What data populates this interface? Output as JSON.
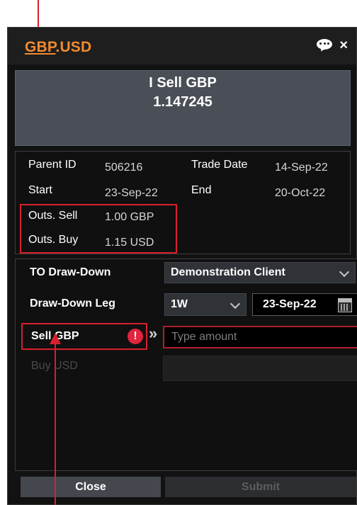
{
  "window": {
    "title_base": "GBP",
    "title_rest": ".USD",
    "icons": [
      "chat-icon",
      "close-icon"
    ],
    "close_glyph": "×"
  },
  "rate": {
    "direction": "I Sell GBP",
    "value": "1.147245"
  },
  "info": {
    "parent_id_label": "Parent ID",
    "parent_id_value": "506216",
    "trade_date_label": "Trade Date",
    "trade_date_value": "14-Sep-22",
    "start_label": "Start",
    "start_value": "23-Sep-22",
    "end_label": "End",
    "end_value": "20-Oct-22",
    "outs_sell_label": "Outs. Sell",
    "outs_sell_value": "1.00 GBP",
    "outs_buy_label": "Outs. Buy",
    "outs_buy_value": "1.15 USD"
  },
  "form": {
    "to_drawdown_label": "TO Draw-Down",
    "to_drawdown_value": "Demonstration Client",
    "drawdown_leg_label": "Draw-Down Leg",
    "drawdown_leg_value": "1W",
    "drawdown_date": "23-Sep-22",
    "sell_label": "Sell GBP",
    "warning_glyph": "!",
    "arrow_glyph": "»",
    "amount_placeholder": "Type amount",
    "buy_label": "Buy USD"
  },
  "buttons": {
    "close": "Close",
    "submit": "Submit"
  },
  "colors": {
    "accent_orange": "#f28a2f",
    "annotation_red": "#d8202c",
    "warning_red": "#e2243e",
    "panel_bg": "#121212"
  }
}
